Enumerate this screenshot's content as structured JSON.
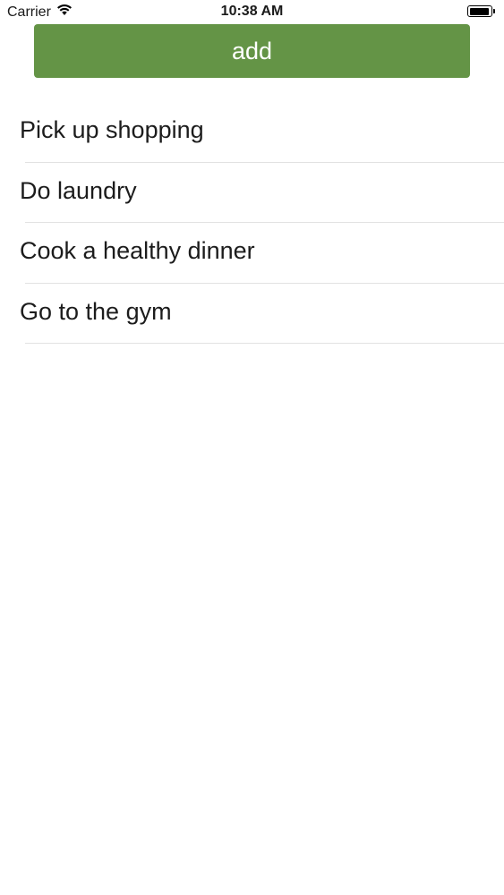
{
  "status_bar": {
    "carrier": "Carrier",
    "time": "10:38 AM",
    "battery_level": 0.95,
    "wifi_icon": "wifi-icon",
    "battery_icon": "battery-icon"
  },
  "toolbar": {
    "add_label": "add",
    "accent_color": "#649446"
  },
  "todos": [
    {
      "label": "Pick up shopping"
    },
    {
      "label": "Do laundry"
    },
    {
      "label": "Cook a healthy dinner"
    },
    {
      "label": "Go to the gym"
    }
  ]
}
